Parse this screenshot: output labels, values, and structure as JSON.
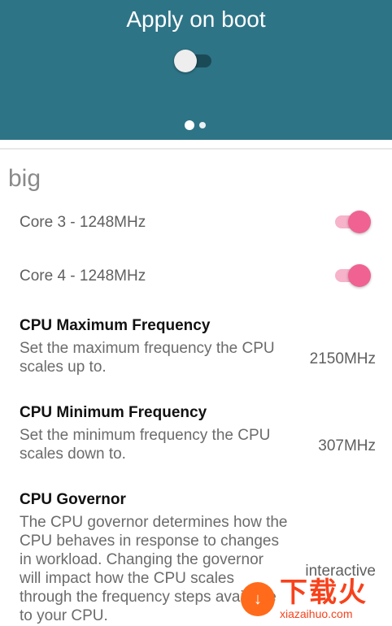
{
  "header": {
    "title": "Apply on boot",
    "apply_on_boot_enabled": false,
    "page_indicator": {
      "count": 2,
      "active_index": 0
    }
  },
  "section": {
    "title": "big"
  },
  "cores": [
    {
      "label": "Core 3 - 1248MHz",
      "enabled": true
    },
    {
      "label": "Core 4 - 1248MHz",
      "enabled": true
    }
  ],
  "prefs": {
    "cpu_max": {
      "title": "CPU Maximum Frequency",
      "summary": "Set the maximum frequency the CPU scales up to.",
      "value": "2150MHz"
    },
    "cpu_min": {
      "title": "CPU Minimum Frequency",
      "summary": "Set the minimum frequency the CPU scales down to.",
      "value": "307MHz"
    },
    "governor": {
      "title": "CPU Governor",
      "summary": "The CPU governor determines how the CPU behaves in response to changes in workload. Changing the governor will impact how the CPU scales through the frequency steps available to your CPU.",
      "value": "interactive"
    }
  },
  "colors": {
    "header_bg": "#2e7487",
    "accent_pink": "#f06292",
    "watermark_orange": "#f7421c"
  },
  "watermark": {
    "text_big": "下载火",
    "text_small": "xiazaihuo.com"
  }
}
